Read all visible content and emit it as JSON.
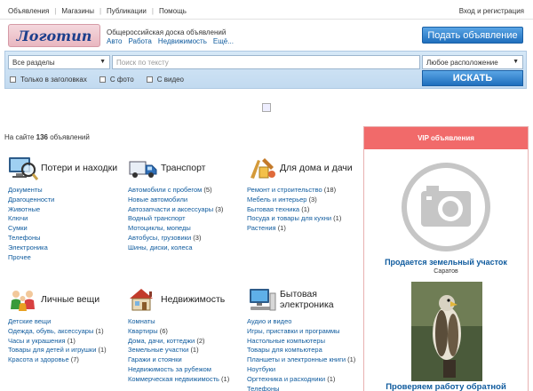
{
  "topnav": {
    "links": [
      "Объявления",
      "Магазины",
      "Публикации",
      "Помощь"
    ],
    "login": "Вход и регистрация"
  },
  "header": {
    "logo": "Логотип",
    "tagline": "Общероссийская доска объявлений",
    "quick_categories": [
      "Авто",
      "Работа",
      "Недвижимость",
      "Ещё..."
    ],
    "post_button": "Подать объявление"
  },
  "search": {
    "category_select": "Все разделы",
    "query_placeholder": "Поиск по тексту",
    "location_select": "Любое расположение",
    "only_titles": "Только в заголовках",
    "with_photo": "С фото",
    "with_video": "С видео",
    "find_button": "ИСКАТЬ"
  },
  "counter": {
    "prefix": "На сайте",
    "count": "136",
    "suffix": "объявлений"
  },
  "categories": [
    {
      "title": "Потери и находки",
      "icon": "lost-found-icon",
      "items": [
        {
          "label": "Документы",
          "count": ""
        },
        {
          "label": "Драгоценности",
          "count": ""
        },
        {
          "label": "Животные",
          "count": ""
        },
        {
          "label": "Ключи",
          "count": ""
        },
        {
          "label": "Сумки",
          "count": ""
        },
        {
          "label": "Телефоны",
          "count": ""
        },
        {
          "label": "Электроника",
          "count": ""
        },
        {
          "label": "Прочее",
          "count": ""
        }
      ]
    },
    {
      "title": "Транспорт",
      "icon": "truck-icon",
      "items": [
        {
          "label": "Автомобили с пробегом",
          "count": "(5)"
        },
        {
          "label": "Новые автомобили",
          "count": ""
        },
        {
          "label": "Автозапчасти и аксессуары",
          "count": "(3)"
        },
        {
          "label": "Водный транспорт",
          "count": ""
        },
        {
          "label": "Мотоциклы, мопеды",
          "count": ""
        },
        {
          "label": "Автобусы, грузовики",
          "count": "(3)"
        },
        {
          "label": "Шины, диски, колеса",
          "count": ""
        }
      ]
    },
    {
      "title": "Для дома и дачи",
      "icon": "home-tools-icon",
      "items": [
        {
          "label": "Ремонт и строительство",
          "count": "(18)"
        },
        {
          "label": "Мебель и интерьер",
          "count": "(3)"
        },
        {
          "label": "Бытовая техника",
          "count": "(1)"
        },
        {
          "label": "Посуда и товары для кухни",
          "count": "(1)"
        },
        {
          "label": "Растения",
          "count": "(1)"
        }
      ]
    },
    {
      "title": "Личные вещи",
      "icon": "people-icon",
      "items": [
        {
          "label": "Детские вещи",
          "count": ""
        },
        {
          "label": "Одежда, обувь, аксессуары",
          "count": "(1)"
        },
        {
          "label": "Часы и украшения",
          "count": "(1)"
        },
        {
          "label": "Товары для детей и игрушки",
          "count": "(1)"
        },
        {
          "label": "Красота и здоровье",
          "count": "(7)"
        }
      ]
    },
    {
      "title": "Недвижимость",
      "icon": "house-icon",
      "items": [
        {
          "label": "Комнаты",
          "count": ""
        },
        {
          "label": "Квартиры",
          "count": "(6)"
        },
        {
          "label": "Дома, дачи, коттеджи",
          "count": "(2)"
        },
        {
          "label": "Земельные участки",
          "count": "(1)"
        },
        {
          "label": "Гаражи и стоянки",
          "count": ""
        },
        {
          "label": "Недвижимость за рубежом",
          "count": ""
        },
        {
          "label": "Коммерческая недвижимость",
          "count": "(1)"
        }
      ]
    },
    {
      "title": "Бытовая электроника",
      "icon": "computer-icon",
      "items": [
        {
          "label": "Аудио и видео",
          "count": ""
        },
        {
          "label": "Игры, приставки и программы",
          "count": ""
        },
        {
          "label": "Настольные компьютеры",
          "count": ""
        },
        {
          "label": "Товары для компьютера",
          "count": ""
        },
        {
          "label": "Планшеты и электронные книги",
          "count": "(1)"
        },
        {
          "label": "Ноутбуки",
          "count": ""
        },
        {
          "label": "Оргтехника и расходники",
          "count": "(1)"
        },
        {
          "label": "Телефоны",
          "count": ""
        }
      ]
    }
  ],
  "vip": {
    "header": "VIP объявления",
    "ad1_title": "Продается земельный участок",
    "ad1_city": "Саратов",
    "ad2_title": "Проверяем работу обратной"
  }
}
